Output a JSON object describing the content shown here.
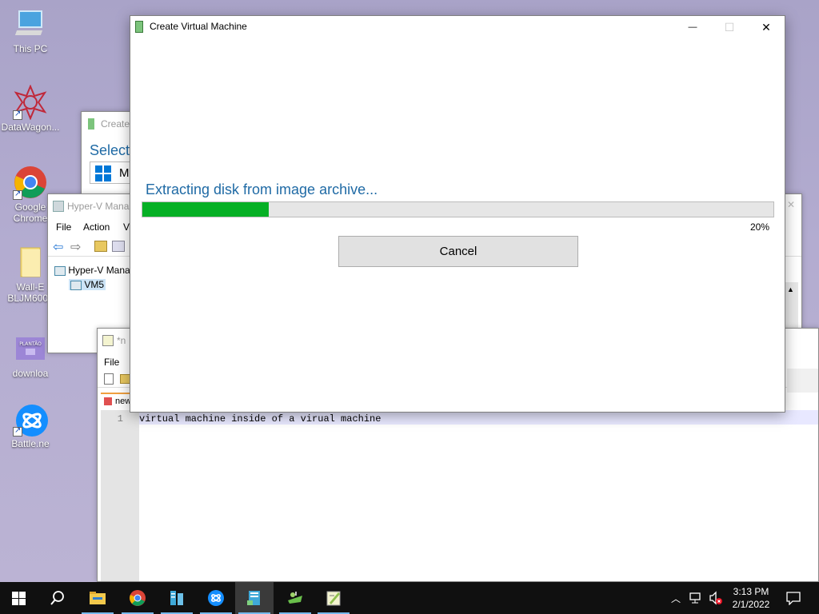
{
  "desktop": {
    "icons": [
      {
        "label": "This PC"
      },
      {
        "label": "DataWagon..."
      },
      {
        "label": "Google Chrome"
      },
      {
        "label": "Wall-E BLJM6008"
      },
      {
        "label": "downloa"
      },
      {
        "label": "Battle.ne"
      }
    ]
  },
  "background_windows": {
    "create_vm_back": {
      "title": "Create",
      "heading": "Select",
      "item1": "M"
    },
    "hyperv_manager": {
      "title": "Hyper-V Mana",
      "menu": [
        "File",
        "Action",
        "V"
      ],
      "tree_root": "Hyper-V Mana",
      "tree_child": "VM5"
    },
    "notepad": {
      "title": "*n",
      "menu_file": "File",
      "tab_label": "new",
      "line_number": "1",
      "line_text": "virtual machine inside of a virual machine"
    }
  },
  "dialog": {
    "title": "Create Virtual Machine",
    "status_text": "Extracting disk from image archive...",
    "progress_percent": 20,
    "progress_label": "20%",
    "cancel_label": "Cancel",
    "minimize_label": "—",
    "maximize_label": "☐",
    "close_label": "✕"
  },
  "taskbar": {
    "icons": [
      "start-icon",
      "search-icon",
      "file-explorer-icon",
      "chrome-icon",
      "server-manager-icon",
      "battlenet-icon",
      "hyperv-icon",
      "datawagon-icon",
      "notepad-plus-icon"
    ],
    "time": "3:13 PM",
    "date": "2/1/2022"
  },
  "colors": {
    "accent_text": "#1f6aa5",
    "progress_fill": "#06b025",
    "taskbar": "#101010"
  }
}
